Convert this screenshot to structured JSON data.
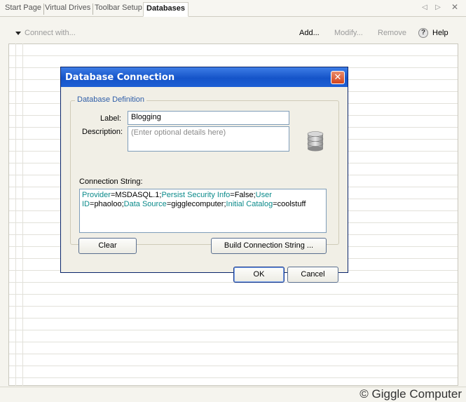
{
  "tabs": [
    {
      "label": "Start Page"
    },
    {
      "label": "Virtual Drives"
    },
    {
      "label": "Toolbar Setup"
    },
    {
      "label": "Databases",
      "active": true
    }
  ],
  "tab_nav": {
    "prev": "◁",
    "next": "▷",
    "close": "✕"
  },
  "toolbar": {
    "connect": "Connect with...",
    "add": "Add...",
    "modify": "Modify...",
    "remove": "Remove",
    "help": "Help",
    "help_icon_glyph": "?"
  },
  "dialog": {
    "title": "Database Connection",
    "close_glyph": "✕",
    "group_title": "Database Definition",
    "label_caption": "Label:",
    "label_value": "Blogging",
    "description_caption": "Description:",
    "description_placeholder": "(Enter optional details here)",
    "connection_caption": "Connection String:",
    "connection_string": [
      {
        "key": "Provider",
        "value": "MSDASQL.1;"
      },
      {
        "key": "Persist Security Info",
        "value": "False;"
      },
      {
        "key": "User ID",
        "value": "phaoloo;"
      },
      {
        "key": "Data Source",
        "value": "gigglecomputer;"
      },
      {
        "key": "Initial Catalog",
        "value": "coolstuff"
      }
    ],
    "clear_button": "Clear",
    "build_button": "Build Connection String ...",
    "ok_button": "OK",
    "cancel_button": "Cancel"
  },
  "status": {
    "copyright": "© Giggle Computer"
  },
  "colors": {
    "title_bar": "#1554c9",
    "key_text": "#0a8a8a",
    "group_title": "#2f5ea8"
  }
}
